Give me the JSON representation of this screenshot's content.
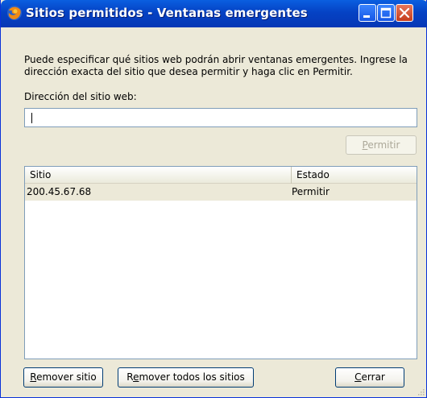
{
  "window": {
    "title": "Sitios permitidos - Ventanas emergentes"
  },
  "description": "Puede especificar qué sitios web podrán abrir ventanas emergentes. Ingrese la dirección exacta del sitio que desea permitir y haga clic en Permitir.",
  "address": {
    "label": "Dirección del sitio web:",
    "value": ""
  },
  "allow_button": {
    "label": "Permitir",
    "accel": "P",
    "rest": "ermitir",
    "enabled": false
  },
  "list": {
    "columns": [
      "Sitio",
      "Estado"
    ],
    "rows": [
      {
        "site": "200.45.67.68",
        "state": "Permitir"
      }
    ]
  },
  "buttons": {
    "remove": {
      "accel": "R",
      "rest": "emover sitio"
    },
    "remove_all": {
      "pre": "R",
      "accel": "e",
      "rest": "mover todos los sitios"
    },
    "close": {
      "accel": "C",
      "rest": "errar"
    }
  },
  "colors": {
    "titlebar": "#0542c4",
    "close_button": "#c53d1c",
    "dialog_bg": "#ece9d8",
    "list_border": "#7f9db9"
  },
  "icons": {
    "app": "firefox-icon",
    "minimize": "minimize-icon",
    "maximize": "maximize-icon",
    "close": "close-icon"
  }
}
